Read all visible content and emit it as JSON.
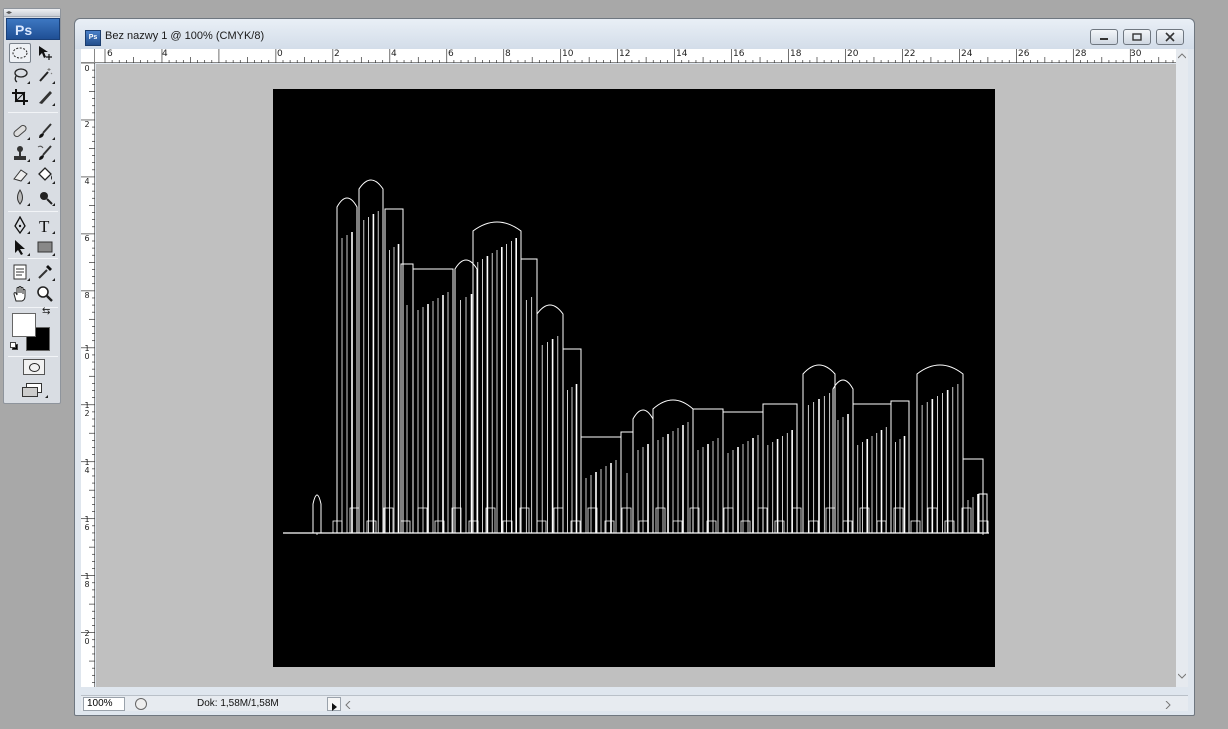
{
  "app": {
    "logo_text": "Ps"
  },
  "document": {
    "title": "Bez nazwy 1 @ 100% (CMYK/8)",
    "icon_text": "Ps"
  },
  "rulers": {
    "top_labels": [
      "6",
      "4",
      "0",
      "2",
      "4",
      "6",
      "8",
      "10",
      "12",
      "14",
      "16",
      "18",
      "20",
      "22",
      "24",
      "26",
      "28",
      "30"
    ],
    "left_labels": [
      "0",
      "2",
      "4",
      "6",
      "8",
      "1\n0",
      "1\n2",
      "1\n4",
      "1\n6",
      "1\n8",
      "2\n0"
    ]
  },
  "status": {
    "zoom": "100%",
    "doc_size": "Dok: 1,58M/1,58M"
  },
  "tools": [
    "elliptical-marquee-tool",
    "move-tool",
    "lasso-tool",
    "magic-wand-tool",
    "crop-tool",
    "slice-tool",
    "healing-brush-tool",
    "brush-tool",
    "clone-stamp-tool",
    "history-brush-tool",
    "eraser-tool",
    "paint-bucket-tool",
    "blur-tool",
    "dodge-tool",
    "pen-tool",
    "type-tool",
    "path-selection-tool",
    "rectangle-tool",
    "notes-tool",
    "eyedropper-tool",
    "hand-tool",
    "zoom-tool"
  ],
  "colors": {
    "foreground": "#ffffff",
    "background": "#000000",
    "canvas": "#000000",
    "artwork_stroke": "#ffffff"
  }
}
